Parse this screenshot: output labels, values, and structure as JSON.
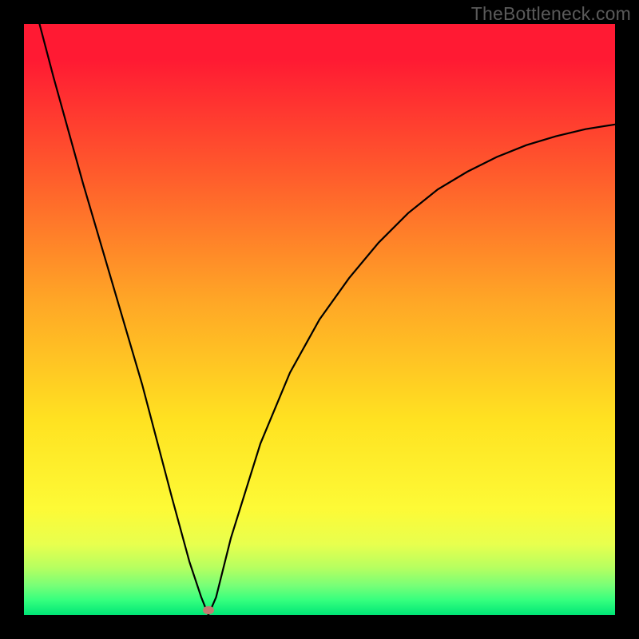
{
  "watermark": "TheBottleneck.com",
  "marker": {
    "x_frac": 0.312,
    "y_frac": 0.992
  },
  "chart_data": {
    "type": "line",
    "title": "",
    "xlabel": "",
    "ylabel": "",
    "xlim": [
      0,
      100
    ],
    "ylim": [
      0,
      100
    ],
    "x": [
      0,
      5,
      10,
      15,
      20,
      25,
      28,
      30,
      31.2,
      32.5,
      35,
      40,
      45,
      50,
      55,
      60,
      65,
      70,
      75,
      80,
      85,
      90,
      95,
      100
    ],
    "y": [
      110,
      91,
      73,
      56,
      39,
      20,
      9,
      3,
      0,
      3,
      13,
      29,
      41,
      50,
      57,
      63,
      68,
      72,
      75,
      77.5,
      79.5,
      81,
      82.2,
      83
    ],
    "series": [
      {
        "name": "bottleneck-curve",
        "color": "#000000"
      }
    ],
    "gradient_stops": [
      {
        "pos": 0.0,
        "color": "#ff1a33"
      },
      {
        "pos": 0.25,
        "color": "#ff5a2c"
      },
      {
        "pos": 0.47,
        "color": "#ffa726"
      },
      {
        "pos": 0.67,
        "color": "#ffe221"
      },
      {
        "pos": 0.82,
        "color": "#fdfa36"
      },
      {
        "pos": 0.92,
        "color": "#b6ff60"
      },
      {
        "pos": 1.0,
        "color": "#00e676"
      }
    ],
    "annotations": [
      {
        "text": "TheBottleneck.com",
        "role": "watermark"
      }
    ]
  }
}
